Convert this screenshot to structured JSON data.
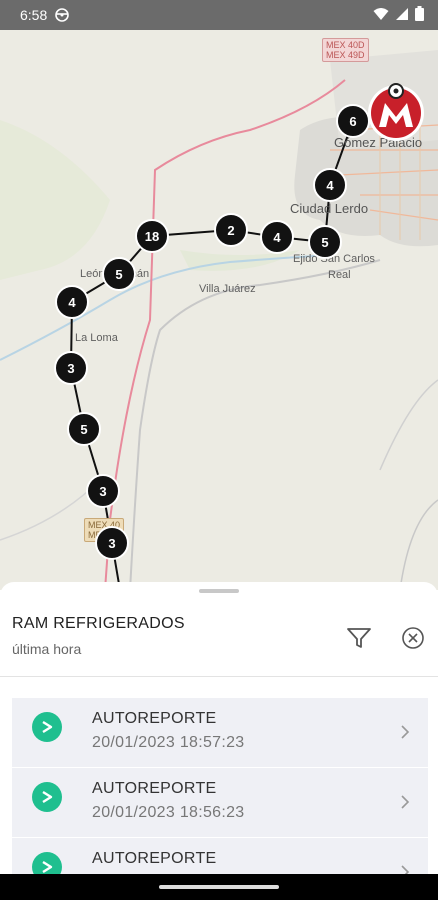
{
  "status_bar": {
    "time": "6:58",
    "icons": [
      "steering-wheel-icon",
      "wifi-icon",
      "signal-icon",
      "battery-icon"
    ]
  },
  "map": {
    "place_labels": {
      "gomez_palacio": "Gómez Palacio",
      "ciudad_lerdo": "Ciudad Lerdo",
      "ejido_san_carlos": "Ejido San Carlos",
      "real": "Real",
      "leon_guzman": "León Guzmán",
      "villa_juarez": "Villa Juárez",
      "la_loma": "La Loma"
    },
    "shields": {
      "top_line1": "MEX 40D",
      "top_line2": "MEX 49D",
      "bottom_line1": "MEX 40",
      "bottom_line2": "MEX 49"
    },
    "clusters": [
      "6",
      "4",
      "5",
      "4",
      "2",
      "18",
      "5",
      "4",
      "3",
      "5",
      "3",
      "3"
    ]
  },
  "sheet": {
    "title": "RAM REFRIGERADOS",
    "subtitle": "última hora",
    "filter_icon": "filter-icon",
    "close_icon": "close-circle-icon",
    "items": [
      {
        "title": "AUTOREPORTE",
        "time": "20/01/2023 18:57:23"
      },
      {
        "title": "AUTOREPORTE",
        "time": "20/01/2023 18:56:23"
      },
      {
        "title": "AUTOREPORTE",
        "time": ""
      }
    ]
  },
  "colors": {
    "accent_green": "#1fbf8f",
    "cluster_black": "#121212",
    "route_red": "#e07a8a",
    "marker_red": "#c8202a"
  }
}
